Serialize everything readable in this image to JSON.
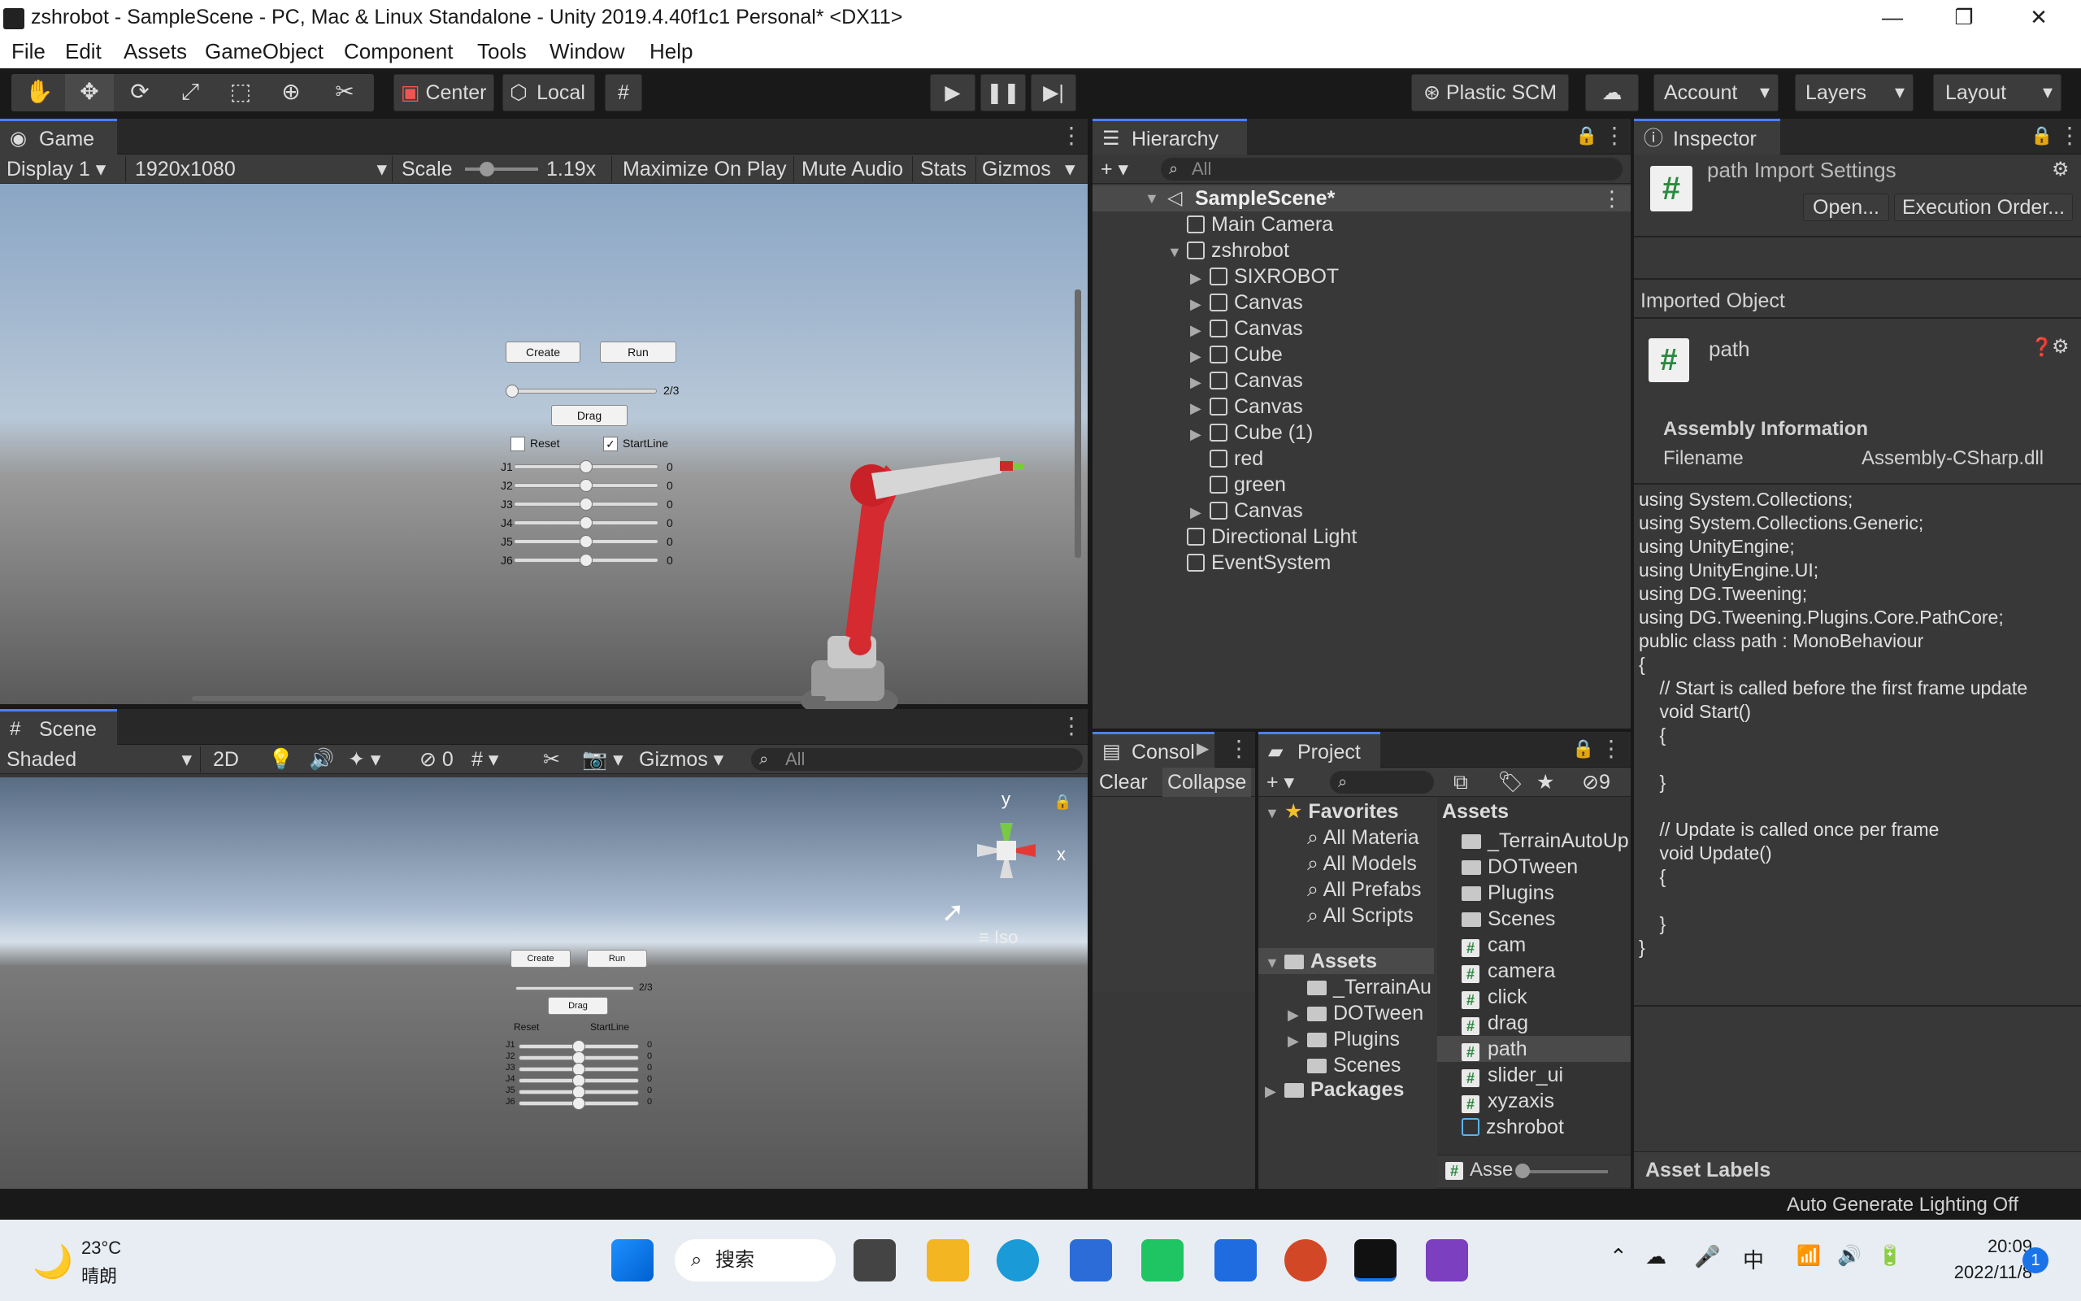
{
  "window": {
    "title": "zshrobot - SampleScene - PC, Mac & Linux Standalone - Unity 2019.4.40f1c1 Personal* <DX11>",
    "minimize": "—",
    "maximize": "❐",
    "close": "✕"
  },
  "menu": [
    "File",
    "Edit",
    "Assets",
    "GameObject",
    "Component",
    "Tools",
    "Window",
    "Help"
  ],
  "toolbar": {
    "center": "Center",
    "local": "Local",
    "plastic": "Plastic SCM",
    "account": "Account",
    "layers": "Layers",
    "layout": "Layout"
  },
  "game": {
    "tab": "Game",
    "display": "Display 1",
    "resolution": "1920x1080",
    "scale_label": "Scale",
    "scale_value": "1.19x",
    "maximize": "Maximize On Play",
    "mute": "Mute Audio",
    "stats": "Stats",
    "gizmos": "Gizmos"
  },
  "robot_ui": {
    "create": "Create",
    "run": "Run",
    "drag": "Drag",
    "fraction": "2/3",
    "reset": "Reset",
    "startline": "StartLine",
    "joints": [
      "J1",
      "J2",
      "J3",
      "J4",
      "J5",
      "J6"
    ],
    "joint_values": [
      "0",
      "0",
      "0",
      "0",
      "0",
      "0"
    ]
  },
  "scene": {
    "tab": "Scene",
    "shading": "Shaded",
    "mode_2d": "2D",
    "hidden_count": "0",
    "gizmos": "Gizmos",
    "search_placeholder": "All",
    "axis_y": "y",
    "axis_x": "x",
    "iso": "Iso"
  },
  "hierarchy": {
    "tab": "Hierarchy",
    "search_placeholder": "All",
    "scene": "SampleScene*",
    "items": [
      {
        "label": "Main Camera",
        "arrow": ""
      },
      {
        "label": "zshrobot",
        "arrow": "▼"
      },
      {
        "label": "SIXROBOT",
        "arrow": "▶"
      },
      {
        "label": "Canvas",
        "arrow": "▶"
      },
      {
        "label": "Canvas",
        "arrow": "▶"
      },
      {
        "label": "Cube",
        "arrow": "▶"
      },
      {
        "label": "Canvas",
        "arrow": "▶"
      },
      {
        "label": "Canvas",
        "arrow": "▶"
      },
      {
        "label": "Cube (1)",
        "arrow": "▶"
      },
      {
        "label": "red",
        "arrow": ""
      },
      {
        "label": "green",
        "arrow": ""
      },
      {
        "label": "Canvas",
        "arrow": "▶"
      },
      {
        "label": "Directional Light",
        "arrow": ""
      },
      {
        "label": "EventSystem",
        "arrow": ""
      }
    ]
  },
  "console": {
    "tab": "Consol",
    "clear": "Clear",
    "collapse": "Collapse"
  },
  "project": {
    "tab": "Project",
    "hidden_count": "9",
    "favorites_label": "Favorites",
    "favorites": [
      "All Materia",
      "All Models",
      "All Prefabs",
      "All Scripts"
    ],
    "assets_label": "Assets",
    "asset_tree": [
      "_TerrainAu",
      "DOTween",
      "Plugins",
      "Scenes"
    ],
    "packages_label": "Packages",
    "breadcrumb": "Assets",
    "files": [
      {
        "label": "_TerrainAutoUp",
        "kind": "folder"
      },
      {
        "label": "DOTween",
        "kind": "folder"
      },
      {
        "label": "Plugins",
        "kind": "folder"
      },
      {
        "label": "Scenes",
        "kind": "folder"
      },
      {
        "label": "cam",
        "kind": "script"
      },
      {
        "label": "camera",
        "kind": "script"
      },
      {
        "label": "click",
        "kind": "script"
      },
      {
        "label": "drag",
        "kind": "script"
      },
      {
        "label": "path",
        "kind": "script"
      },
      {
        "label": "slider_ui",
        "kind": "script"
      },
      {
        "label": "xyzaxis",
        "kind": "script"
      },
      {
        "label": "zshrobot",
        "kind": "prefab"
      }
    ],
    "footer": "Asse"
  },
  "inspector": {
    "tab": "Inspector",
    "title": "path Import Settings",
    "open": "Open...",
    "execution_order": "Execution Order...",
    "imported_object": "Imported Object",
    "object_name": "path",
    "assembly_info": "Assembly Information",
    "filename_label": "Filename",
    "filename_value": "Assembly-CSharp.dll",
    "code": "using System.Collections;\nusing System.Collections.Generic;\nusing UnityEngine;\nusing UnityEngine.UI;\nusing DG.Tweening;\nusing DG.Tweening.Plugins.Core.PathCore;\npublic class path : MonoBehaviour\n{\n    // Start is called before the first frame update\n    void Start()\n    {\n\n    }\n\n    // Update is called once per frame\n    void Update()\n    {\n\n    }\n}",
    "asset_labels": "Asset Labels"
  },
  "status": "Auto Generate Lighting Off",
  "taskbar": {
    "temperature": "23°C",
    "weather": "晴朗",
    "search": "搜索",
    "ime": "中",
    "time": "20:09",
    "date": "2022/11/8",
    "notifications": "1"
  },
  "colors": {
    "accent": "#4c7fff",
    "panel": "#383838",
    "script_green": "#2b8a3e",
    "robot_red": "#d42a30"
  }
}
